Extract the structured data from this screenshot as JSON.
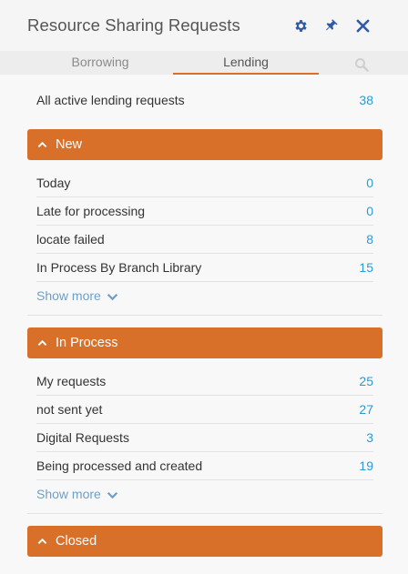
{
  "header": {
    "title": "Resource Sharing Requests",
    "icons": [
      "gear-icon",
      "pin-icon",
      "close-icon"
    ],
    "accent_color": "#2f5aa8"
  },
  "tabs": {
    "items": [
      {
        "label": "Borrowing",
        "active": false
      },
      {
        "label": "Lending",
        "active": true
      }
    ],
    "search_icon": "search-icon",
    "active_color": "#d8702a"
  },
  "summary": {
    "label": "All active lending requests",
    "count": "38"
  },
  "sections": [
    {
      "title": "New",
      "rows": [
        {
          "label": "Today",
          "count": "0"
        },
        {
          "label": "Late for processing",
          "count": "0"
        },
        {
          "label": "locate failed",
          "count": "8"
        },
        {
          "label": "In Process By Branch Library",
          "count": "15"
        }
      ],
      "show_more": "Show more"
    },
    {
      "title": "In Process",
      "rows": [
        {
          "label": "My requests",
          "count": "25"
        },
        {
          "label": "not sent yet",
          "count": "27"
        },
        {
          "label": "Digital Requests",
          "count": "3"
        },
        {
          "label": "Being processed and created",
          "count": "19"
        }
      ],
      "show_more": "Show more"
    },
    {
      "title": "Closed",
      "rows": []
    }
  ],
  "colors": {
    "section_bg": "#d8702a",
    "count_text": "#2b9ad1",
    "show_more_text": "#6d9fcc"
  }
}
